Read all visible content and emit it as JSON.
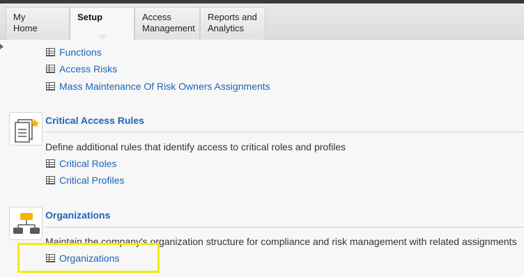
{
  "tabs": [
    {
      "line1": "My",
      "line2": "Home"
    },
    {
      "line1": "Setup",
      "line2": ""
    },
    {
      "line1": "Access",
      "line2": "Management"
    },
    {
      "line1": "Reports and",
      "line2": "Analytics"
    }
  ],
  "top_links": [
    "Functions",
    "Access Risks",
    "Mass Maintenance Of Risk Owners Assignments"
  ],
  "critical_access": {
    "title": "Critical Access Rules",
    "description": "Define additional rules that identify access to critical roles and profiles",
    "links": [
      "Critical Roles",
      "Critical Profiles"
    ]
  },
  "organizations": {
    "title": "Organizations",
    "description": "Maintain the company's organization structure for compliance and risk management with related assignments",
    "links": [
      "Organizations"
    ]
  },
  "colors": {
    "link": "#1a64b8",
    "highlight": "#f2ea0a",
    "org_icon": "#f5b400",
    "org_icon_secondary": "#5a5a5a"
  }
}
